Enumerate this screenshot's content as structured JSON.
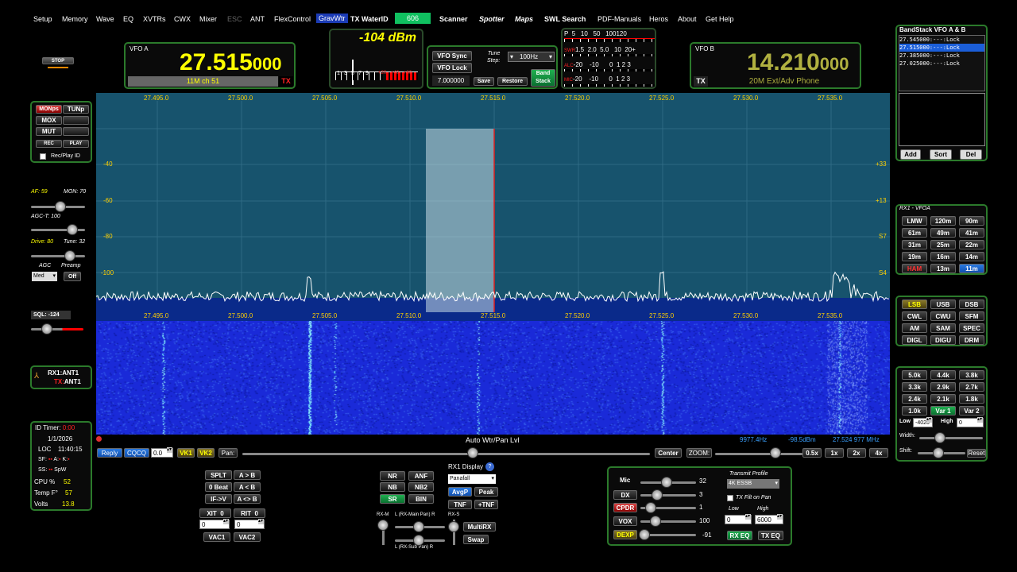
{
  "menu": {
    "items": [
      "Setup",
      "Memory",
      "Wave",
      "EQ",
      "XVTRs",
      "CWX",
      "Mixer",
      "ESC",
      "ANT",
      "FlexControl",
      "GravWtr",
      "TX WaterID",
      "606",
      "Scanner",
      "Spotter",
      "Maps",
      "SWL Search",
      "PDF-Manuals",
      "Heros",
      "About",
      "Get Help"
    ]
  },
  "stop_label": "STOP",
  "vfoA": {
    "label": "VFO A",
    "freq_main": "27.515",
    "freq_sub": "000",
    "mode": "11M ch 51",
    "tx": "TX"
  },
  "meter": {
    "value": "-104 dBm",
    "scale": [
      "1",
      "3",
      "5",
      "7",
      "9",
      "+20",
      "+40",
      "+60"
    ]
  },
  "vfo_controls": {
    "sync": "VFO Sync",
    "lock": "VFO Lock",
    "freq": "7.000000",
    "tune_step_label": "Tune\nStep:",
    "tune_step": "100Hz",
    "save": "Save",
    "restore": "Restore",
    "band_stack": "Band\nStack"
  },
  "tx_meter": {
    "p_scale": [
      "P",
      "5",
      "10",
      "50",
      "100",
      "120"
    ],
    "swr_label": "SWR",
    "swr_scale": [
      "1.5",
      "2.0",
      "5.0",
      "10",
      "20+"
    ],
    "alc_label": "ALC",
    "alc_scale": [
      "-20",
      "-10",
      "0",
      "1",
      "2",
      "3"
    ],
    "mic_label": "MIC",
    "mic_scale": [
      "-20",
      "-10",
      "0",
      "1",
      "2",
      "3"
    ]
  },
  "vfoB": {
    "label": "VFO B",
    "freq_main": "14.210",
    "freq_sub": "000",
    "mode": "20M Ext/Adv Phone",
    "tx": "TX"
  },
  "bandstack": {
    "title": "BandStack VFO A & B",
    "entries": [
      "27.545000:---:Lock",
      "27.515000:---:Lock",
      "27.385000:---:Lock",
      "27.025000:---:Lock"
    ],
    "add": "Add",
    "sort": "Sort",
    "del": "Del"
  },
  "left": {
    "mon": "MONps",
    "tun": "TUNp",
    "mox": "MOX",
    "mut": "MUT",
    "rec": "REC",
    "play": "PLAY",
    "recplay": "Rec/Play ID",
    "af": "AF: 59",
    "mon_level": "MON: 70",
    "agct": "AGC-T: 100",
    "drive": "Drive: 80",
    "tune": "Tune: 32",
    "agc": "AGC",
    "preamp": "Preamp",
    "agc_val": "Med",
    "preamp_val": "Off",
    "sql": "SQL: -124",
    "rx1ant": "RX1:ANT1",
    "txant_tx": "TX:",
    "txant": "ANT1",
    "id_timer": "ID Timer:",
    "id_val": "0:00",
    "date": "1/1/2026",
    "loc": "LOC",
    "time": "11:40:15",
    "sf": "SF:",
    "sf_a": "A:",
    "sf_k": "K:",
    "ss": "SS:",
    "spw": "SpW",
    "cpu": "CPU %",
    "cpu_val": "52",
    "temp": "Temp F°",
    "temp_val": "57",
    "volts": "Volts",
    "volts_val": "13.8"
  },
  "display": {
    "freq_labels": [
      "27.495.0",
      "27.500.0",
      "27.505.0",
      "27.510.0",
      "27.515.0",
      "27.520.0",
      "27.525.0",
      "27.530.0",
      "27.535.0"
    ],
    "dbm_left": [
      "-40",
      "-60",
      "-80",
      "-100"
    ],
    "dbm_right": [
      "+33",
      "+13",
      "S7",
      "S4"
    ],
    "status_title": "Auto Wtr/Pan Lvl",
    "status_bw": "9977.4Hz",
    "status_dbm": "-98.5dBm",
    "status_freq": "27.524 977 MHz"
  },
  "pan": {
    "reply": "Reply",
    "cqcq": "CQCQ",
    "spin": "0.0",
    "vk1": "VK1",
    "vk2": "VK2",
    "pan": "Pan:",
    "center": "Center",
    "zoom": "ZOOM:",
    "z1": "0.5x",
    "z2": "1x",
    "z3": "2x",
    "z4": "4x"
  },
  "rx1": {
    "title": "RX1 - VFOA",
    "bands": [
      "LMW",
      "120m",
      "90m",
      "61m",
      "49m",
      "41m",
      "31m",
      "25m",
      "22m",
      "19m",
      "16m",
      "14m",
      "HAM",
      "13m",
      "11m"
    ],
    "modes": [
      "LSB",
      "USB",
      "DSB",
      "CWL",
      "CWU",
      "SFM",
      "AM",
      "SAM",
      "SPEC",
      "DIGL",
      "DIGU",
      "DRM"
    ],
    "filters": [
      "5.0k",
      "4.4k",
      "3.8k",
      "3.3k",
      "2.9k",
      "2.7k",
      "2.4k",
      "2.1k",
      "1.8k",
      "1.0k",
      "Var 1",
      "Var 2"
    ],
    "low": "Low",
    "low_val": "-4020",
    "high": "High",
    "high_val": "0",
    "width": "Width:",
    "shift": "Shift:",
    "reset": "Reset"
  },
  "bottom_left": {
    "splt": "SPLT",
    "atob": "A > B",
    "zerobeat": "0 Beat",
    "altb": "A < B",
    "ifv": "IF->V",
    "aswap": "A <> B",
    "xit": "XIT",
    "xit_val": "0",
    "rit": "RIT",
    "rit_val": "0",
    "xit_spin": "0",
    "rit_spin": "0",
    "vac1": "VAC1",
    "vac2": "VAC2"
  },
  "dsp": {
    "nr": "NR",
    "anf": "ANF",
    "nb": "NB",
    "nb2": "NB2",
    "sr": "SR",
    "bin": "BIN",
    "display_label": "RX1 Display",
    "display_mode": "Panafall",
    "avgp": "AvgP",
    "peak": "Peak",
    "tnf": "TNF",
    "ptnf": "+TNF",
    "rxm": "RX-M",
    "rxs": "RX-S",
    "main_pan": "L (RX-Main Pan) R",
    "sub_pan": "L (RX-Sub Pan) R",
    "multirx": "MultiRX",
    "swap": "Swap"
  },
  "tx": {
    "mic": "Mic",
    "mic_val": "32",
    "dx": "DX",
    "dx_val": "3",
    "cpdr": "CPDR",
    "cpdr_val": "1",
    "vox": "VOX",
    "vox_val": "100",
    "dexp": "DEXP",
    "dexp_val": "-91",
    "profile_label": "Transmit Profile",
    "profile": "4K ESSB",
    "tx_filt": "TX Filt on Pan",
    "low": "Low",
    "high": "High",
    "low_val": "0",
    "high_val": "6000",
    "rxeq": "RX EQ",
    "txeq": "TX EQ"
  },
  "colors": {
    "spectrum_bg": "#17536d",
    "waterfall": "#1a2ad8",
    "frame": "#2b7a2b",
    "vfoA_freq": "#ffff00",
    "vfoB_freq": "#b0b040",
    "filter": "#c8dde5"
  }
}
